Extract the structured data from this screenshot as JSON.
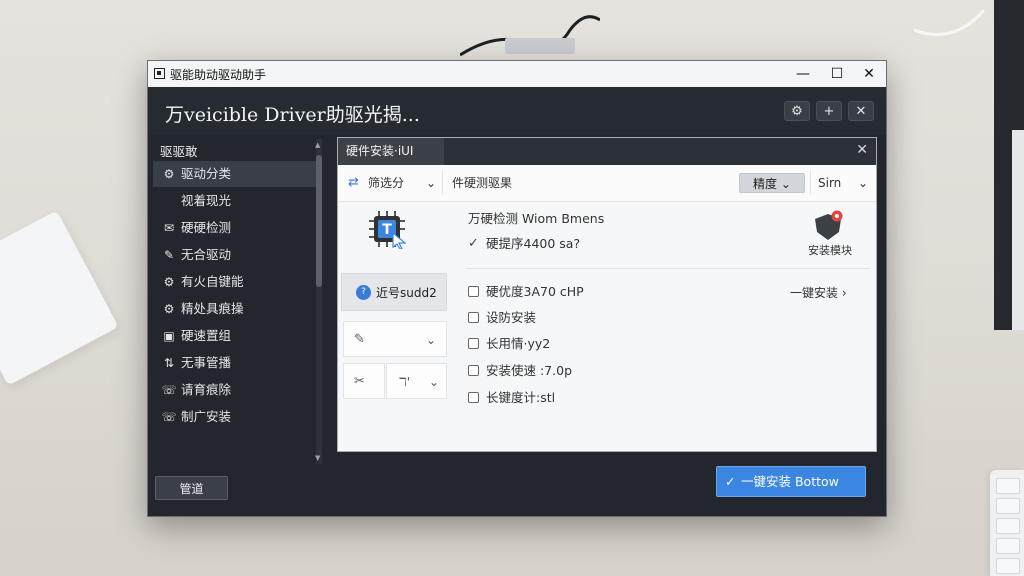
{
  "window": {
    "titlebar_title": "驱能助动驱动助手",
    "app_title": "万veicible Driver助驱光揭...",
    "controls": {
      "minimize": "—",
      "maximize": "☐",
      "close": "✕"
    },
    "header_buttons": [
      "⚙",
      "+",
      "✕"
    ]
  },
  "sidebar": {
    "heading": "驱驱敢",
    "items": [
      {
        "icon": "⚙",
        "label": "驱动分类",
        "active": true
      },
      {
        "icon": "",
        "label": "视着现光",
        "active": false
      },
      {
        "icon": "✉",
        "label": "硬硬检测",
        "active": false
      },
      {
        "icon": "✎",
        "label": "无合驱动",
        "active": false
      },
      {
        "icon": "⚙",
        "label": "有火自键能",
        "active": false
      },
      {
        "icon": "⚙",
        "label": "精处具痕操",
        "active": false
      },
      {
        "icon": "▣",
        "label": "硬速置组",
        "active": false
      },
      {
        "icon": "⇅",
        "label": "无事管播",
        "active": false
      },
      {
        "icon": "☏",
        "label": "请育痕除",
        "active": false
      },
      {
        "icon": "☏",
        "label": "制广安装",
        "active": false
      }
    ],
    "footer_button": "管道"
  },
  "panel": {
    "tab_label": "硬件安装·iUI",
    "close_icon": "✕",
    "toolbar": {
      "filter_label": "筛选分",
      "filter_caret": "⌄",
      "result_label": "件硬测驱果",
      "sort_label": "精度",
      "sort_caret": "⌄",
      "view_label": "Sirn",
      "view_caret": "⌄"
    },
    "left": {
      "driver_button": "近号sudd2",
      "driver_badge": "?",
      "row1_caret": "⌄",
      "row2_text": "ℸ'",
      "row2_caret": "⌄"
    },
    "info_title": "万硬检测 Wiom Bmens",
    "checkbox_checked": "硬提序4400 sa?",
    "checkboxes": [
      {
        "label": "硬优度3A70 cHP",
        "checked": false
      },
      {
        "label": "设防安装",
        "checked": false
      },
      {
        "label": "长用情·yy2",
        "checked": false
      },
      {
        "label": "安装使速 :7.0p",
        "checked": false
      },
      {
        "label": "长键度计:stl",
        "checked": false
      }
    ],
    "one_key_link": "一键安装 ›",
    "shield_label": "安装模块"
  },
  "install_button": {
    "icon": "✓",
    "label": "一键安装  Bottow"
  },
  "colors": {
    "accent": "#3a86e0",
    "window_bg": "#23272d",
    "panel_bg": "#f6f7f8",
    "shield_red": "#e2453c"
  }
}
